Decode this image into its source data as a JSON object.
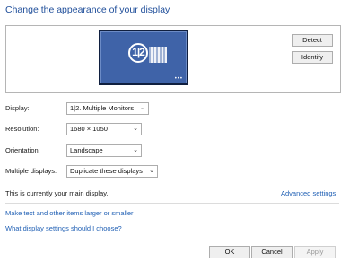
{
  "title": "Change the appearance of your display",
  "preview": {
    "monitor_badge": "1|2",
    "detect_button": "Detect",
    "identify_button": "Identify"
  },
  "settings": {
    "display_label": "Display:",
    "display_value": "1|2. Multiple Monitors",
    "resolution_label": "Resolution:",
    "resolution_value": "1680 × 1050",
    "orientation_label": "Orientation:",
    "orientation_value": "Landscape",
    "multiple_label": "Multiple displays:",
    "multiple_value": "Duplicate these displays"
  },
  "info_text": "This is currently your main display.",
  "advanced_link": "Advanced settings",
  "links": {
    "text_size": "Make text and other items larger or smaller",
    "which_settings": "What display settings should I choose?"
  },
  "buttons": {
    "ok": "OK",
    "cancel": "Cancel",
    "apply": "Apply"
  },
  "colors": {
    "title": "#1f4e9a",
    "link": "#1f5fb4",
    "monitor": "#3f63a8"
  }
}
